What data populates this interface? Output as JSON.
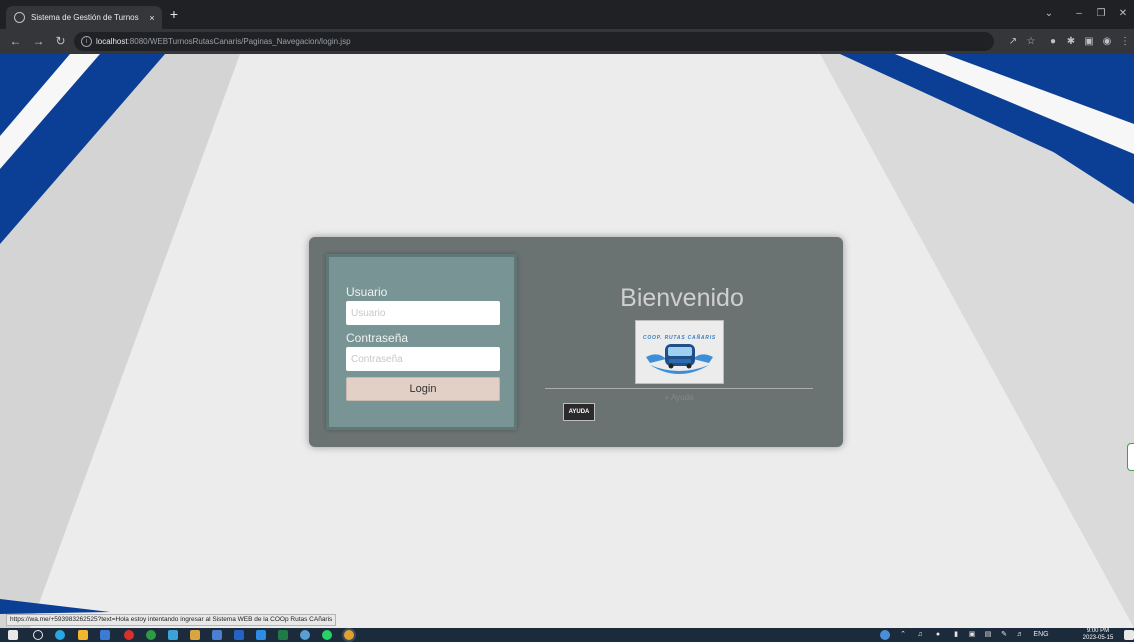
{
  "browser": {
    "tab_title": "Sistema de Gestión de Turnos \"F",
    "tab_close": "×",
    "new_tab": "+",
    "url_host": "localhost",
    "url_rest": ":8080/WEBTurnosRutasCanaris/Paginas_Navegacion/login.jsp",
    "icons": [
      "back-icon",
      "forward-icon",
      "reload-icon",
      "info-icon",
      "share-icon",
      "star-icon",
      "extension-icon",
      "puzzle-icon",
      "sidebar-icon",
      "profile-icon",
      "menu-icon"
    ]
  },
  "login": {
    "user_label": "Usuario",
    "user_placeholder": "Usuario",
    "password_label": "Contraseña",
    "password_placeholder": "Contraseña",
    "login_button": "Login"
  },
  "welcome": {
    "heading": "Bienvenido",
    "logo_text": "COOP. RUTAS CAÑARIS",
    "help_link": "+ Ayuda",
    "help_button": "AYUDA"
  },
  "status_url": "https://wa.me/+593983262525?text=Hola estoy intentando ingresar al Sistema WEB de la COOp Rutas CAñaris",
  "taskbar": {
    "language": "ENG",
    "time": "9:00 PM",
    "date": "2023-05-15"
  },
  "colors": {
    "card": "#6b7272",
    "form_panel": "#789494",
    "login_button": "#e2cfc5",
    "accent_blue": "#0b3f95"
  }
}
